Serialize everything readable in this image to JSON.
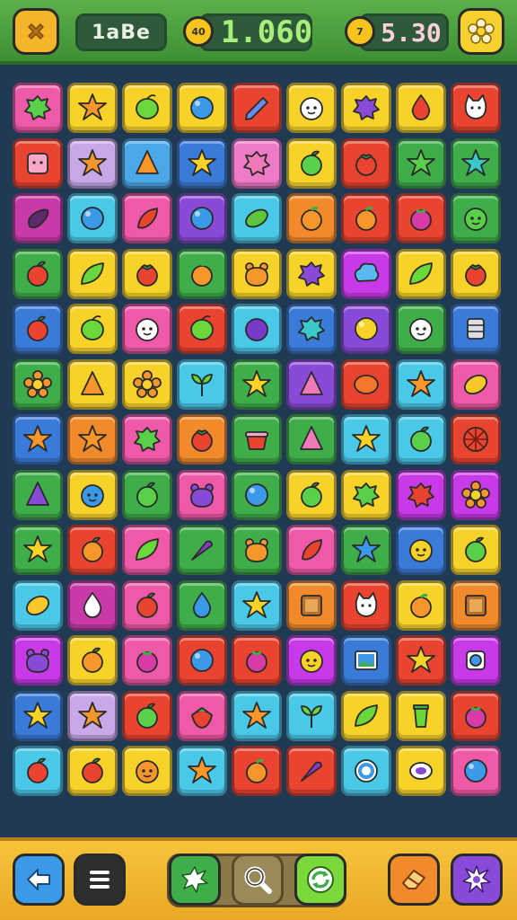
{
  "hud": {
    "level_label": "1aBe",
    "score": "1.060",
    "score_coin_label": "40",
    "time": "5.30",
    "time_coin_label": "7",
    "close_icon": "close-icon",
    "settings_icon": "gear-icon"
  },
  "board": {
    "cols": 9,
    "rows": 13,
    "tiles": [
      [
        "#ef5aa8",
        "splat-green"
      ],
      [
        "#f7d32a",
        "star-orange"
      ],
      [
        "#f7d32a",
        "lime"
      ],
      [
        "#f7d32a",
        "ball-blue"
      ],
      [
        "#e8442f",
        "crayon-blue"
      ],
      [
        "#f7d32a",
        "face-white"
      ],
      [
        "#f7d32a",
        "splat-purple"
      ],
      [
        "#f7d32a",
        "drop-red"
      ],
      [
        "#e8442f",
        "cat-white"
      ],
      [
        "#e8442f",
        "square-pink"
      ],
      [
        "#c9a8e8",
        "star-orange"
      ],
      [
        "#4aa8e8",
        "cone-orange"
      ],
      [
        "#3a7ad8",
        "star-yellow"
      ],
      [
        "#ef7ac8",
        "splat-pink"
      ],
      [
        "#f7d32a",
        "apple-green"
      ],
      [
        "#e8442f",
        "tomato"
      ],
      [
        "#3fae4a",
        "star-green"
      ],
      [
        "#3fae4a",
        "star-teal"
      ],
      [
        "#c83aa8",
        "eggplant"
      ],
      [
        "#4ac8e8",
        "ball-blue"
      ],
      [
        "#ef5aa8",
        "chili-red"
      ],
      [
        "#8a4ad8",
        "ball-blue"
      ],
      [
        "#4ac8e8",
        "pickle-green"
      ],
      [
        "#f08a2a",
        "orange"
      ],
      [
        "#e8442f",
        "orange"
      ],
      [
        "#e8442f",
        "berry-pink"
      ],
      [
        "#3fae4a",
        "face-green"
      ],
      [
        "#3fae4a",
        "apple-red"
      ],
      [
        "#f7d32a",
        "leaf-green"
      ],
      [
        "#f7d32a",
        "tomato"
      ],
      [
        "#3fae4a",
        "orange"
      ],
      [
        "#f7d32a",
        "bear-orange"
      ],
      [
        "#f7d32a",
        "splat-purple"
      ],
      [
        "#c83ae8",
        "cloud-blue"
      ],
      [
        "#f7d32a",
        "leaf-green"
      ],
      [
        "#f7d32a",
        "tomato"
      ],
      [
        "#3a7ad8",
        "apple-red"
      ],
      [
        "#f7d32a",
        "lime"
      ],
      [
        "#ef5aa8",
        "face-white"
      ],
      [
        "#e8442f",
        "lime"
      ],
      [
        "#4ac8e8",
        "plum"
      ],
      [
        "#3a7ad8",
        "splat-teal"
      ],
      [
        "#8a4ad8",
        "ball-yellow"
      ],
      [
        "#3fae4a",
        "face-white"
      ],
      [
        "#3a7ad8",
        "can-grey"
      ],
      [
        "#3fae4a",
        "flower-orange"
      ],
      [
        "#f7d32a",
        "cone-orange"
      ],
      [
        "#f7d32a",
        "flower-orange"
      ],
      [
        "#4ac8e8",
        "sprout-green"
      ],
      [
        "#3fae4a",
        "star-yellow"
      ],
      [
        "#8a4ad8",
        "cone-pink"
      ],
      [
        "#e8442f",
        "oval-orange"
      ],
      [
        "#4ac8e8",
        "star-orange"
      ],
      [
        "#ef5aa8",
        "lemon"
      ],
      [
        "#3a7ad8",
        "star-orange"
      ],
      [
        "#f08a2a",
        "star-orange"
      ],
      [
        "#ef5aa8",
        "splat-green"
      ],
      [
        "#f08a2a",
        "tomato"
      ],
      [
        "#3fae4a",
        "bucket-red"
      ],
      [
        "#3fae4a",
        "cone-pink"
      ],
      [
        "#4ac8e8",
        "star-yellow"
      ],
      [
        "#4ac8e8",
        "apple-green"
      ],
      [
        "#e8442f",
        "wheel-red"
      ],
      [
        "#3fae4a",
        "cone-purple"
      ],
      [
        "#f7d32a",
        "face-blue"
      ],
      [
        "#3fae4a",
        "apple-green"
      ],
      [
        "#ef5aa8",
        "bear-purple"
      ],
      [
        "#3fae4a",
        "ball-blue"
      ],
      [
        "#f7d32a",
        "apple-green"
      ],
      [
        "#f7d32a",
        "splat-green"
      ],
      [
        "#c83ae8",
        "splat-red"
      ],
      [
        "#c83ae8",
        "flower-orange"
      ],
      [
        "#3fae4a",
        "star-yellow"
      ],
      [
        "#e8442f",
        "apple-orange"
      ],
      [
        "#ef5aa8",
        "leaf-green"
      ],
      [
        "#3fae4a",
        "carrot-purple"
      ],
      [
        "#3fae4a",
        "bear-orange"
      ],
      [
        "#ef5aa8",
        "chili-red"
      ],
      [
        "#3fae4a",
        "star-blue"
      ],
      [
        "#3a7ad8",
        "face-yellow"
      ],
      [
        "#f7d32a",
        "apple-green"
      ],
      [
        "#4ac8e8",
        "lemon"
      ],
      [
        "#c83aa8",
        "drop-white"
      ],
      [
        "#ef5aa8",
        "apple-red"
      ],
      [
        "#3fae4a",
        "drop-blue"
      ],
      [
        "#4ac8e8",
        "star-yellow"
      ],
      [
        "#f08a2a",
        "box-brown"
      ],
      [
        "#e8442f",
        "cat-white"
      ],
      [
        "#f7d32a",
        "orange"
      ],
      [
        "#f08a2a",
        "box-brown"
      ],
      [
        "#c83ae8",
        "bear-purple"
      ],
      [
        "#f7d32a",
        "apple-orange"
      ],
      [
        "#ef5aa8",
        "berry-pink"
      ],
      [
        "#e8442f",
        "ball-blue"
      ],
      [
        "#e8442f",
        "berry-pink"
      ],
      [
        "#c83ae8",
        "face-yellow"
      ],
      [
        "#3a7ad8",
        "photo-blue"
      ],
      [
        "#e8442f",
        "star-yellow"
      ],
      [
        "#c83ae8",
        "gem-white"
      ],
      [
        "#3a7ad8",
        "star-yellow"
      ],
      [
        "#c9a8e8",
        "star-orange"
      ],
      [
        "#e8442f",
        "apple-green"
      ],
      [
        "#ef5aa8",
        "strawberry"
      ],
      [
        "#4ac8e8",
        "star-orange"
      ],
      [
        "#4ac8e8",
        "sprout-green"
      ],
      [
        "#f7d32a",
        "leaf-green"
      ],
      [
        "#f7d32a",
        "cup-green"
      ],
      [
        "#e8442f",
        "berry-pink"
      ],
      [
        "#4ac8e8",
        "apple-red"
      ],
      [
        "#f7d32a",
        "apple-red"
      ],
      [
        "#f7d32a",
        "face-orange"
      ],
      [
        "#4ac8e8",
        "star-orange"
      ],
      [
        "#e8442f",
        "orange"
      ],
      [
        "#e8442f",
        "carrot-purple"
      ],
      [
        "#4ac8e8",
        "ring-blue"
      ],
      [
        "#f7d32a",
        "egg-white"
      ],
      [
        "#ef5aa8",
        "ball-blue"
      ]
    ]
  },
  "toolbar": {
    "back": {
      "icon": "arrow-left-icon",
      "color": "#3a9ae8"
    },
    "menu": {
      "icon": "menu-icon",
      "color": "#2e2e2e"
    },
    "splash": {
      "icon": "splash-icon",
      "color": "#3fae4a"
    },
    "hint": {
      "icon": "magnifier-icon"
    },
    "shuffle": {
      "icon": "shuffle-icon",
      "color": "#7ad83a"
    },
    "eraser": {
      "icon": "eraser-icon",
      "color": "#f08a2a"
    },
    "bomb": {
      "icon": "burst-icon",
      "color": "#8a4ad8"
    }
  }
}
